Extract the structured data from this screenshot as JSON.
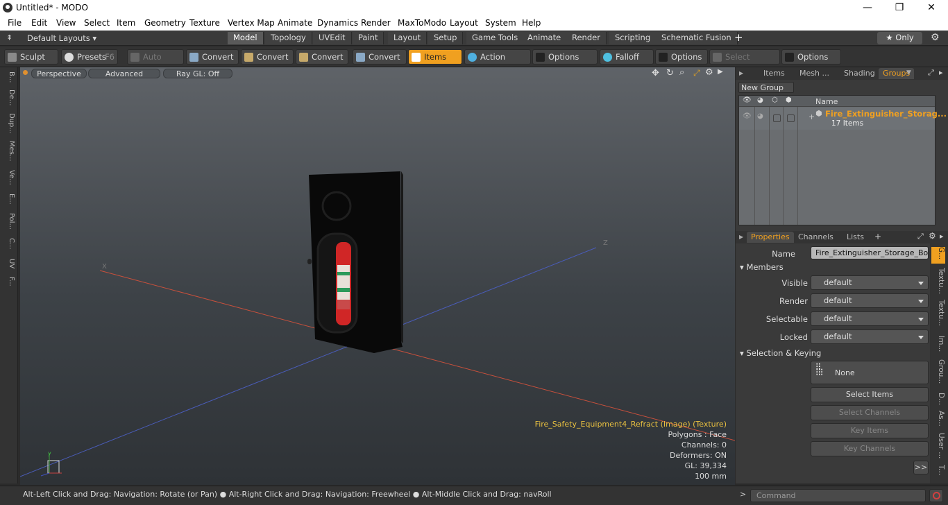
{
  "window": {
    "title": "Untitled* - MODO",
    "min": "—",
    "max": "❐",
    "close": "✕"
  },
  "menu": [
    "File",
    "Edit",
    "View",
    "Select",
    "Item",
    "Geometry",
    "Texture",
    "Vertex Map",
    "Animate",
    "Dynamics",
    "Render",
    "MaxToModo",
    "Layout",
    "System",
    "Help"
  ],
  "layout": {
    "preset": "Default Layouts ▾",
    "tabs": [
      "Model",
      "Topology",
      "UVEdit",
      "Paint",
      "Layout",
      "Setup",
      "Game Tools",
      "Animate",
      "Render",
      "Scripting",
      "Schematic Fusion"
    ],
    "add": "+",
    "only": "★  Only"
  },
  "toolbar": {
    "sculpt": "Sculpt",
    "presets": "Presets",
    "presets_key": "F6",
    "auto_select": "Auto Select",
    "convert": "Convert",
    "items": "Items",
    "action_center": "Action Center",
    "options": "Options",
    "falloff": "Falloff",
    "select_through": "Select Through"
  },
  "lefttabs": [
    "B...",
    "De...",
    "Dup...",
    "Mes...",
    "Ve...",
    "E...",
    "Pol...",
    "C...",
    "UV",
    "F..."
  ],
  "viewport": {
    "perspective": "Perspective",
    "advanced": "Advanced",
    "raygl": "Ray GL: Off",
    "texture": "Fire_Safety_Equipment4_Refract (Image) (Texture)",
    "polygons": "Polygons : Face",
    "channels": "Channels: 0",
    "deformers": "Deformers: ON",
    "gl": "GL: 39,334",
    "scale": "100 mm",
    "axis_x": "X",
    "axis_z": "Z"
  },
  "groups": {
    "tabs": [
      "Items",
      "Mesh ...",
      "Shading",
      "Groups"
    ],
    "new_group": "New Group",
    "col_name": "Name",
    "item_name": "Fire_Extinguisher_Storag...",
    "item_count": "17 Items"
  },
  "props": {
    "tabs": [
      "Properties",
      "Channels",
      "Lists"
    ],
    "name_label": "Name",
    "name_value": "Fire_Extinguisher_Storage_Box_",
    "members": "Members",
    "visible": "Visible",
    "render": "Render",
    "selectable": "Selectable",
    "locked": "Locked",
    "default": "default",
    "sel_keying": "Selection & Keying",
    "none": "None",
    "select_items": "Select Items",
    "select_channels": "Select Channels",
    "key_items": "Key Items",
    "key_channels": "Key Channels",
    "more": ">>"
  },
  "righttabs": [
    "G...",
    "Textu...",
    "Textu...",
    "Im...",
    "Grou...",
    "D...",
    "As...",
    "User ...",
    "T..."
  ],
  "status": {
    "hint": "Alt-Left Click and Drag: Navigation: Rotate (or Pan) ● Alt-Right Click and Drag: Navigation: Freewheel ● Alt-Middle Click and Drag: navRoll",
    "command": "Command"
  }
}
